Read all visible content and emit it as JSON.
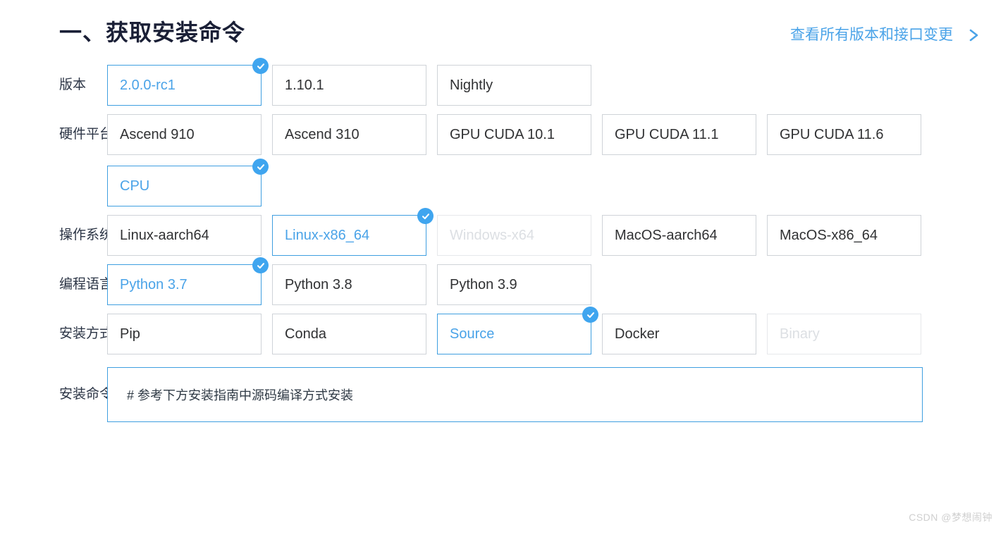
{
  "header": {
    "title": "一、获取安装命令",
    "all_versions_link": "查看所有版本和接口变更",
    "chevron_icon": "chevron-right-icon"
  },
  "rows": [
    {
      "key": "version",
      "label": "版本",
      "options": [
        {
          "label": "2.0.0-rc1",
          "selected": true,
          "disabled": false
        },
        {
          "label": "1.10.1",
          "selected": false,
          "disabled": false
        },
        {
          "label": "Nightly",
          "selected": false,
          "disabled": false
        }
      ]
    },
    {
      "key": "hardware",
      "label": "硬件平台",
      "options": [
        {
          "label": "Ascend 910",
          "selected": false,
          "disabled": false
        },
        {
          "label": "Ascend 310",
          "selected": false,
          "disabled": false
        },
        {
          "label": "GPU CUDA 10.1",
          "selected": false,
          "disabled": false
        },
        {
          "label": "GPU CUDA 11.1",
          "selected": false,
          "disabled": false
        },
        {
          "label": "GPU CUDA 11.6",
          "selected": false,
          "disabled": false
        },
        {
          "label": "CPU",
          "selected": true,
          "disabled": false
        }
      ]
    },
    {
      "key": "os",
      "label": "操作系统",
      "options": [
        {
          "label": "Linux-aarch64",
          "selected": false,
          "disabled": false
        },
        {
          "label": "Linux-x86_64",
          "selected": true,
          "disabled": false
        },
        {
          "label": "Windows-x64",
          "selected": false,
          "disabled": true
        },
        {
          "label": "MacOS-aarch64",
          "selected": false,
          "disabled": false
        },
        {
          "label": "MacOS-x86_64",
          "selected": false,
          "disabled": false
        }
      ]
    },
    {
      "key": "language",
      "label": "编程语言",
      "options": [
        {
          "label": "Python 3.7",
          "selected": true,
          "disabled": false
        },
        {
          "label": "Python 3.8",
          "selected": false,
          "disabled": false
        },
        {
          "label": "Python 3.9",
          "selected": false,
          "disabled": false
        }
      ]
    },
    {
      "key": "install_method",
      "label": "安装方式",
      "options": [
        {
          "label": "Pip",
          "selected": false,
          "disabled": false
        },
        {
          "label": "Conda",
          "selected": false,
          "disabled": false
        },
        {
          "label": "Source",
          "selected": true,
          "disabled": false
        },
        {
          "label": "Docker",
          "selected": false,
          "disabled": false
        },
        {
          "label": "Binary",
          "selected": false,
          "disabled": true
        }
      ]
    }
  ],
  "command": {
    "label": "安装命令",
    "value": "# 参考下方安装指南中源码编译方式安装"
  },
  "watermark": "CSDN @梦想闹钟",
  "colors": {
    "accent": "#3fa5ef",
    "selected_border": "#3f9fe0",
    "selected_text": "#4aa3e8",
    "default_border": "#cfd3d8",
    "default_text": "#303133",
    "disabled_text": "#dcdfe3",
    "disabled_border": "#e6e8eb",
    "title": "#1a1f36",
    "watermark": "#cfcfcf"
  }
}
